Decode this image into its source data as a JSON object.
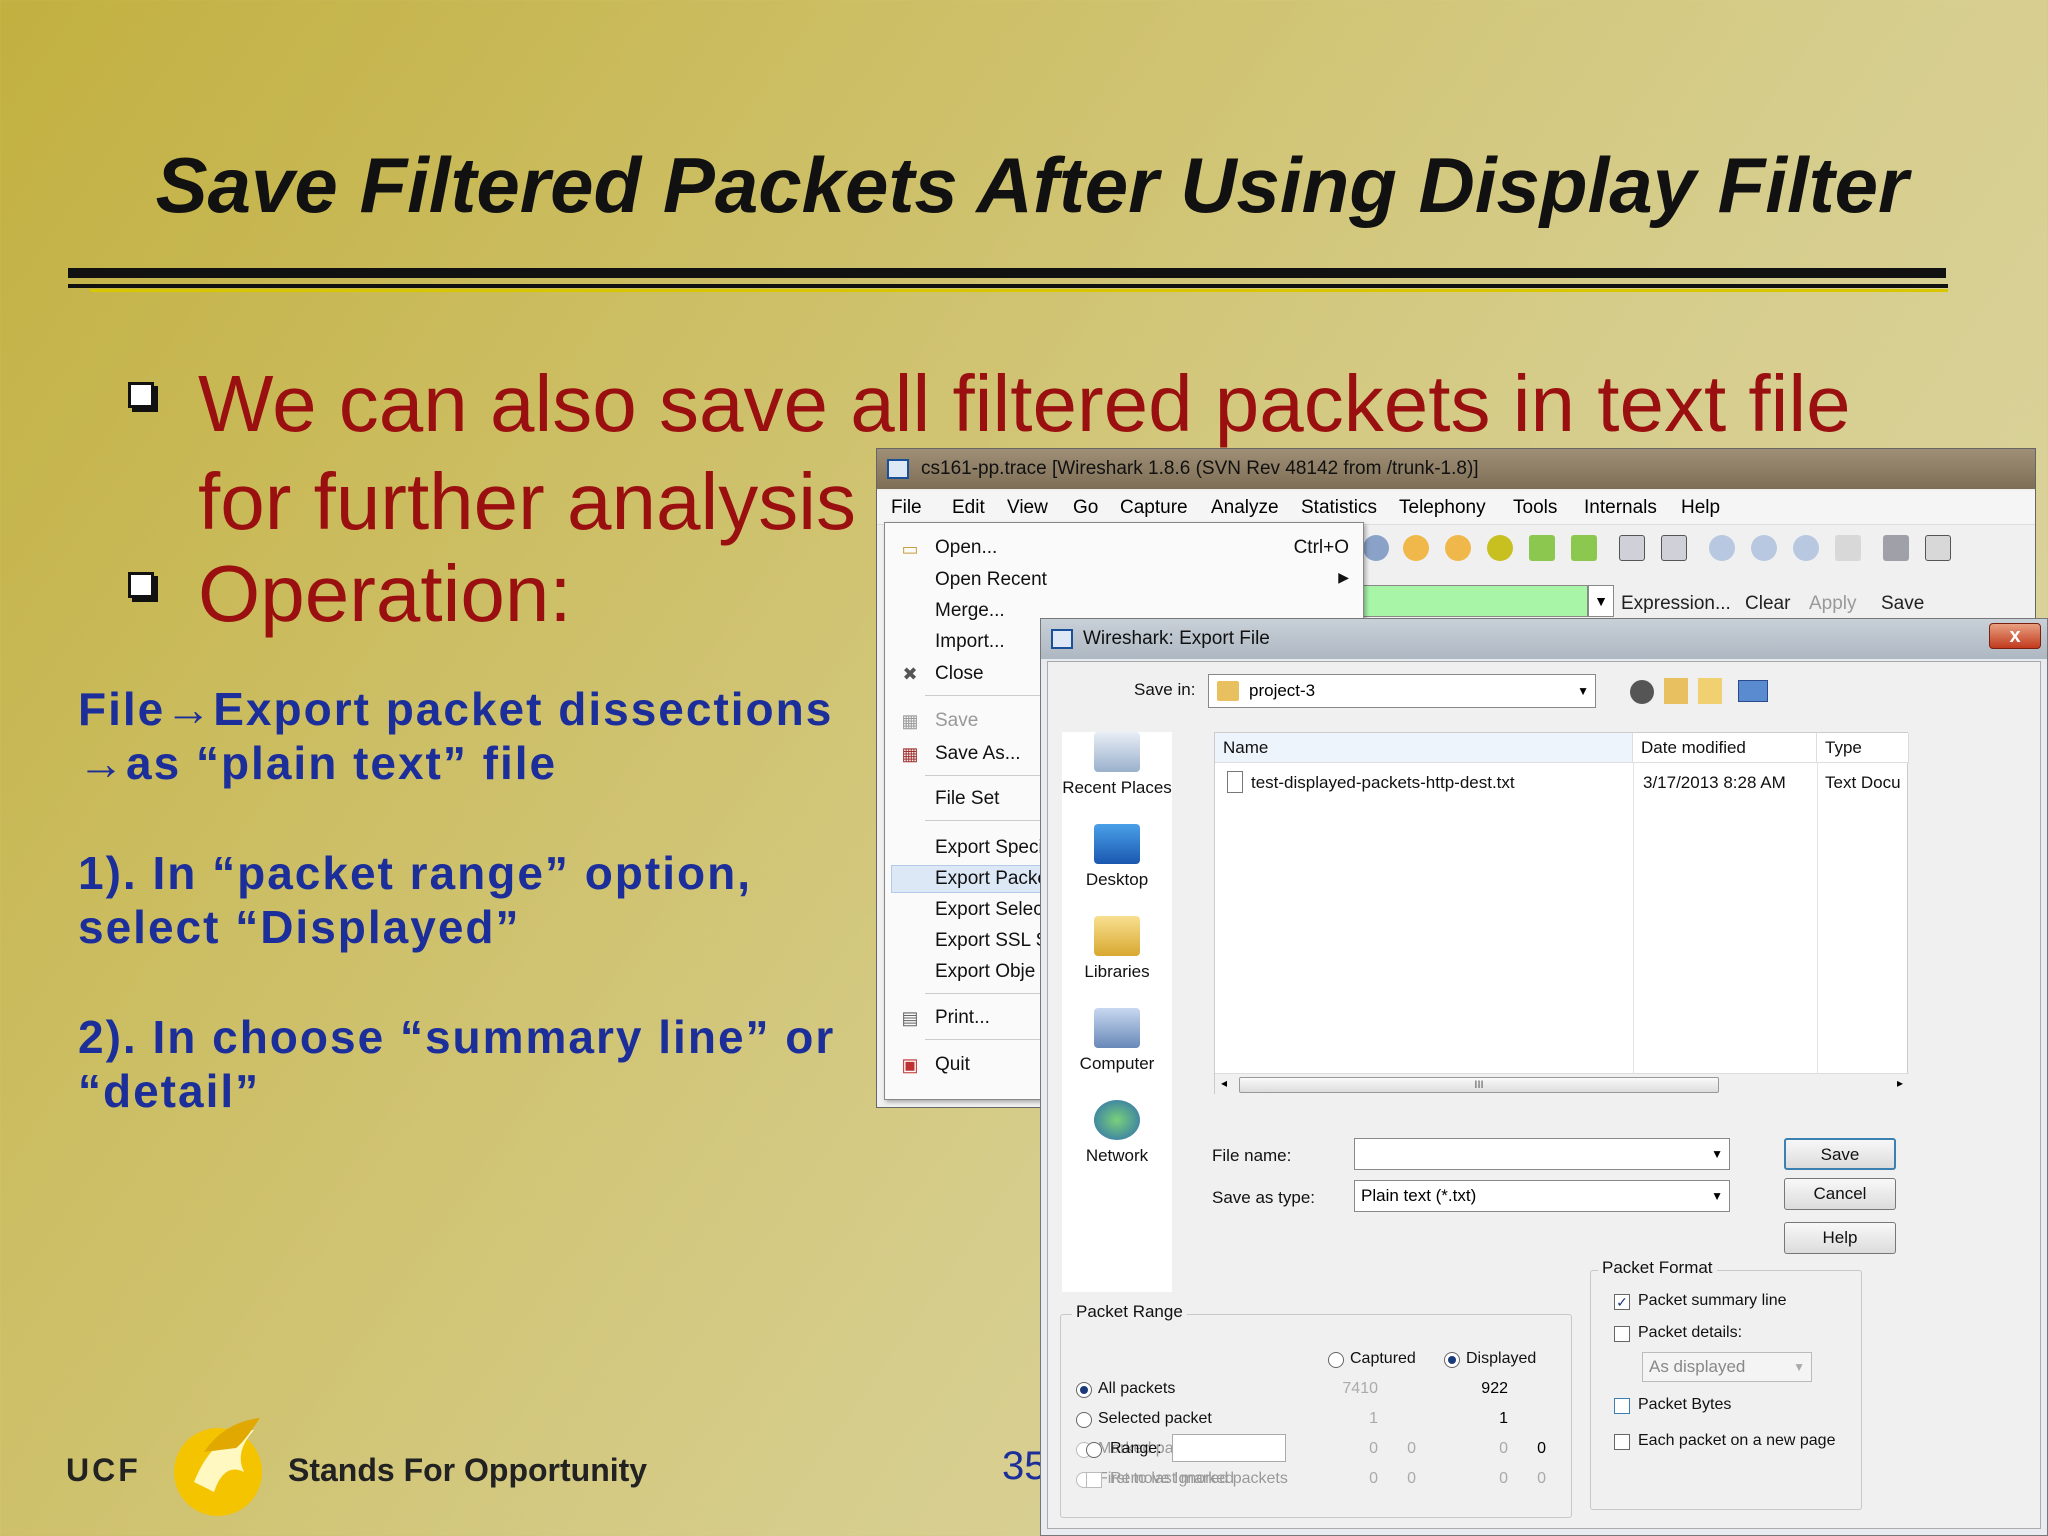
{
  "slide": {
    "title": "Save Filtered Packets After Using Display Filter",
    "bullet1_line1": "We can also save all filtered packets in text file",
    "bullet1_line2": "for further analysis",
    "bullet2": "Operation:",
    "step_line1": "File→Export packet dissections",
    "step_line2": "→as “plain text” file",
    "step1_line1": "1). In “packet range” option,",
    "step1_line2": "select “Displayed”",
    "step2_line1": "2). In choose “summary line” or",
    "step2_line2": "“detail”",
    "footer_ucf": "UCF",
    "footer_tagline": "Stands For Opportunity",
    "page_number": "35"
  },
  "wireshark": {
    "title": "cs161-pp.trace  [Wireshark 1.8.6  (SVN Rev 48142 from /trunk-1.8)]",
    "menus": [
      "File",
      "Edit",
      "View",
      "Go",
      "Capture",
      "Analyze",
      "Statistics",
      "Telephony",
      "Tools",
      "Internals",
      "Help"
    ],
    "filter_links": [
      "Expression...",
      "Clear",
      "Apply",
      "Save"
    ]
  },
  "file_menu": {
    "open": "Open...",
    "open_shortcut": "Ctrl+O",
    "open_recent": "Open Recent",
    "merge": "Merge...",
    "import": "Import...",
    "close": "Close",
    "save": "Save",
    "save_as": "Save As...",
    "file_set": "File Set",
    "export_specified": "Export Speci",
    "export_packet": "Export Packe",
    "export_selected": "Export Selec",
    "export_ssl": "Export SSL S",
    "export_objects": "Export Obje",
    "print": "Print...",
    "quit": "Quit"
  },
  "dialog": {
    "title": "Wireshark: Export File",
    "close_glyph": "x",
    "save_in_label": "Save in:",
    "save_in_value": "project-3",
    "places": [
      "Recent Places",
      "Desktop",
      "Libraries",
      "Computer",
      "Network"
    ],
    "columns": [
      "Name",
      "Date modified",
      "Type"
    ],
    "file": {
      "name": "test-displayed-packets-http-dest.txt",
      "date": "3/17/2013 8:28 AM",
      "type": "Text Docu"
    },
    "scroll_grip": "III",
    "file_name_label": "File name:",
    "file_name_value": "",
    "save_as_type_label": "Save as type:",
    "save_as_type_value": "Plain text (*.txt)",
    "buttons": {
      "save": "Save",
      "cancel": "Cancel",
      "help": "Help"
    },
    "packet_range": {
      "title": "Packet Range",
      "captured": "Captured",
      "displayed": "Displayed",
      "rows": [
        {
          "label": "All packets",
          "captured": "7410",
          "displayed": "922"
        },
        {
          "label": "Selected packet",
          "captured": "1",
          "displayed": "1"
        },
        {
          "label": "Marked packets",
          "captured": "0",
          "displayed": "0"
        },
        {
          "label": "First to last marked",
          "captured": "0",
          "displayed": "0"
        },
        {
          "label": "Range:",
          "captured": "0",
          "displayed": "0"
        },
        {
          "label": "Remove Ignored packets",
          "captured": "0",
          "displayed": "0"
        }
      ]
    },
    "packet_format": {
      "title": "Packet Format",
      "summary_line": "Packet summary line",
      "details": "Packet details:",
      "details_option": "As displayed",
      "bytes": "Packet Bytes",
      "new_page": "Each packet on a new page"
    }
  }
}
